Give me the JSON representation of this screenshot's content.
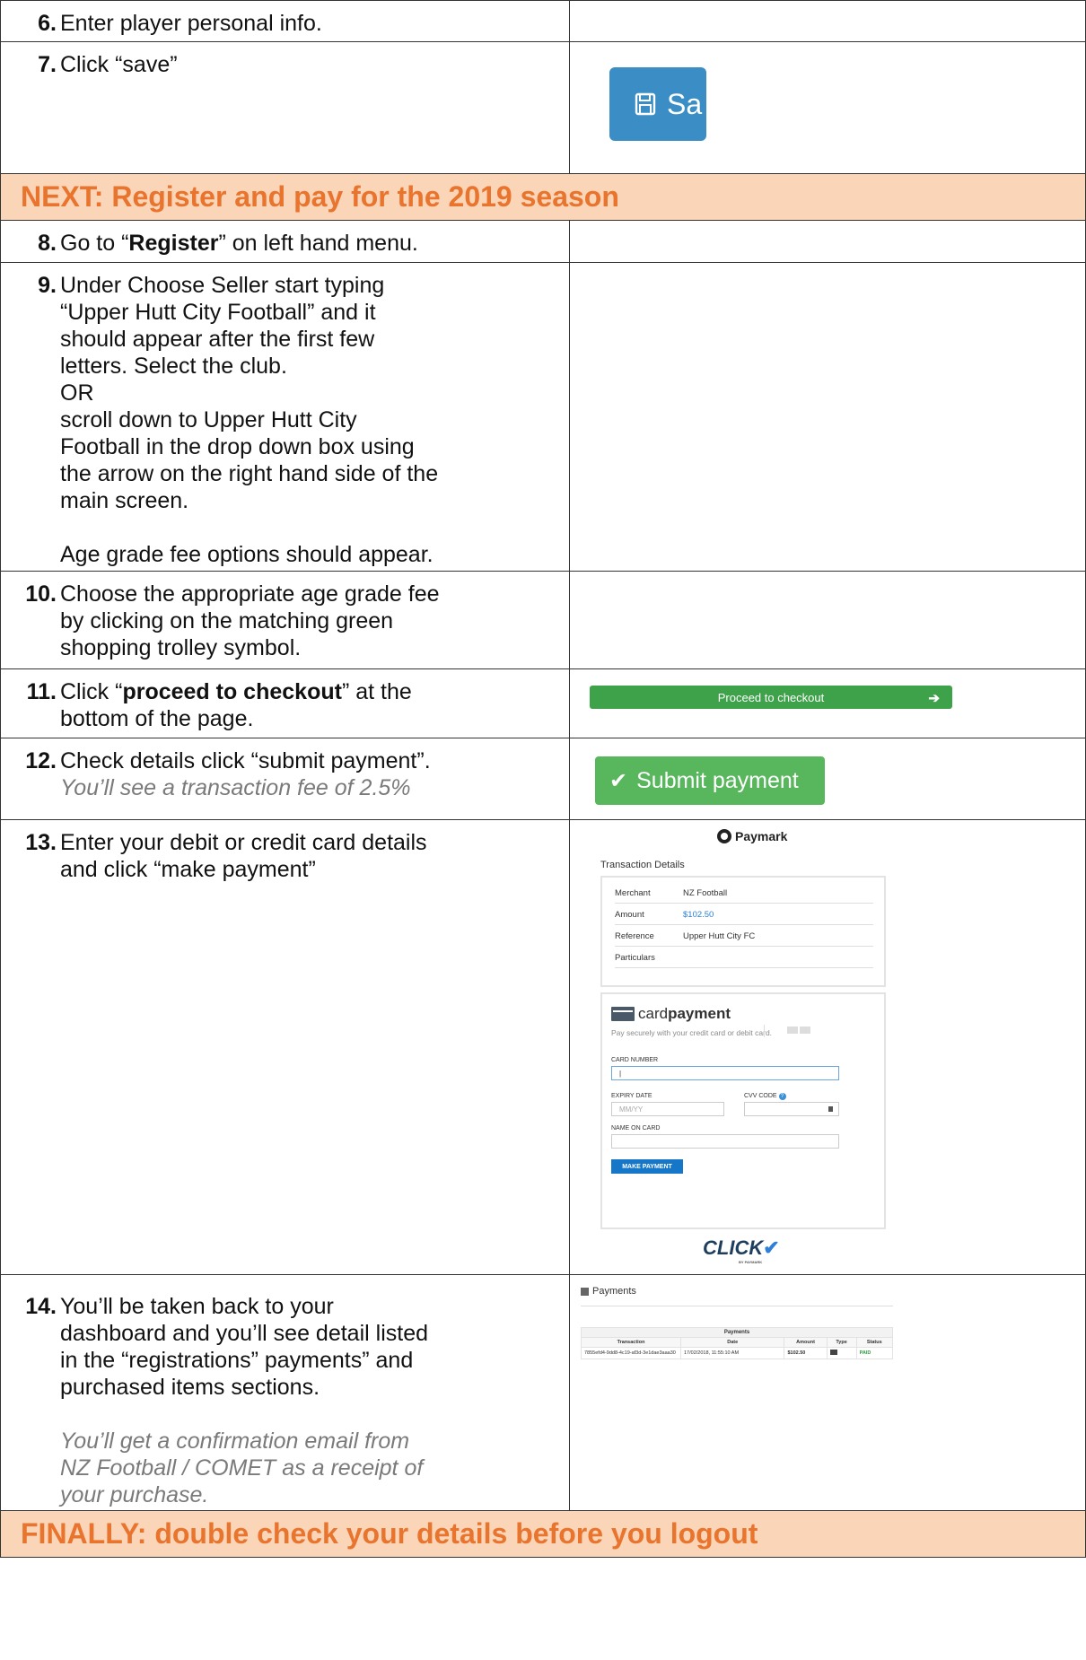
{
  "sections": {
    "next": "NEXT: Register and pay for the 2019 season",
    "finally": "FINALLY: double check your details before you logout"
  },
  "steps": {
    "s6": {
      "num": "6.",
      "text": "Enter player personal info."
    },
    "s7": {
      "num": "7.",
      "pre": "Click “save”"
    },
    "s8": {
      "num": "8.",
      "pre": "Go to “",
      "bold": "Register",
      "post": "” on left hand menu."
    },
    "s9": {
      "num": "9.",
      "lines": [
        "Under Choose Seller start typing",
        "“Upper Hutt City Football” and it",
        "should appear after the first few",
        "letters. Select the club.",
        "OR",
        "scroll down to Upper Hutt City",
        "Football in the drop down box using",
        "the arrow on the right hand side of the",
        "main screen."
      ],
      "after": "Age grade fee options should appear."
    },
    "s10": {
      "num": "10.",
      "lines": [
        "Choose the appropriate age grade fee",
        "by clicking on the matching green",
        "shopping trolley symbol."
      ]
    },
    "s11": {
      "num": "11.",
      "pre": "Click “",
      "bold": "proceed to checkout",
      "post": "” at the",
      "line2": "bottom of the page."
    },
    "s12": {
      "num": "12.",
      "text": "Check details click “submit payment”.",
      "note": "You’ll see a transaction fee of 2.5%"
    },
    "s13": {
      "num": "13.",
      "lines": [
        "Enter your debit or credit card details",
        "and click “make payment”"
      ]
    },
    "s14": {
      "num": "14.",
      "lines": [
        "You’ll be taken back to your",
        "dashboard and you’ll see detail listed",
        "in the “registrations” payments” and",
        "purchased items sections."
      ],
      "note_lines": [
        "You’ll get a confirmation email from",
        "NZ Football / COMET as a receipt of",
        "your purchase."
      ]
    }
  },
  "save_button": {
    "label": "Sa",
    "icon": "floppy-disk-icon"
  },
  "proceed_button": {
    "label": "Proceed to checkout",
    "icon": "arrow-right-icon",
    "color": "#3ea24a"
  },
  "submit_button": {
    "label": "Submit payment",
    "icon": "checkmark-icon",
    "color": "#58b65c"
  },
  "paymark": {
    "brand": "Paymark",
    "title": "Transaction Details",
    "rows": [
      {
        "k": "Merchant",
        "v": "NZ Football"
      },
      {
        "k": "Amount",
        "v": "$102.50"
      },
      {
        "k": "Reference",
        "v": "Upper Hutt City FC"
      },
      {
        "k": "Particulars",
        "v": ""
      }
    ],
    "card_word1": "card",
    "card_word2": "payment",
    "card_sub": "Pay securely with your credit card or debit card.",
    "card_number_label": "CARD NUMBER",
    "card_number_value": "|",
    "expiry_label": "EXPIRY DATE",
    "expiry_placeholder": "MM/YY",
    "cvv_label": "CVV CODE",
    "name_label": "NAME ON CARD",
    "make_payment": "MAKE PAYMENT",
    "click_logo": "CLICK",
    "click_sub": "BY PAYMARK"
  },
  "payments": {
    "heading": "Payments",
    "table_title": "Payments",
    "columns": [
      "Transaction",
      "Date",
      "Amount",
      "Type",
      "Status"
    ],
    "row": {
      "transaction": "7855efd4-9dd8-4c19-af3d-3e1dae3aaa30",
      "date": "17/02/2018, 11:55:10 AM",
      "amount": "$102.50",
      "status": "PAID"
    }
  }
}
